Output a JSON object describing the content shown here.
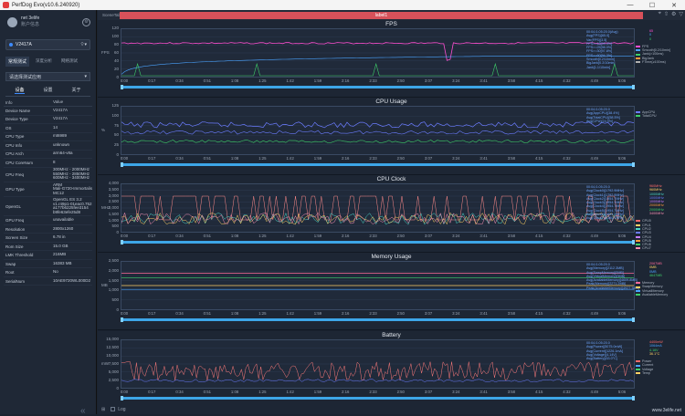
{
  "window": {
    "title": "PerfDog Evo(v10.6.240920)",
    "minimize": "—",
    "maximize": "☐",
    "close": "✕"
  },
  "user": {
    "name": "net 3elife",
    "tag": "账户信息"
  },
  "device": {
    "name": "V2417A"
  },
  "mode_tabs": [
    "常规测试",
    "深度分析",
    "网络测试"
  ],
  "app_select": {
    "placeholder": "请选择测试应用"
  },
  "sub_tabs": [
    "设备",
    "设置",
    "关于"
  ],
  "info_table": {
    "headers": [
      "Info",
      "Value"
    ],
    "rows": [
      [
        "Device Name",
        "V2417A"
      ],
      [
        "Device Type",
        "V2417A"
      ],
      [
        "OS",
        "14"
      ],
      [
        "CPU Type",
        "mt6989"
      ],
      [
        "CPU Info",
        "unknown"
      ],
      [
        "CPU Arch",
        "arm64-v8a"
      ],
      [
        "CPU CoreNum",
        "8"
      ],
      [
        "CPU Freq",
        "300MHz - 2000MHz\n550MHz - 2850MHz\n600MHz - 3400MHz"
      ],
      [
        "GPU Type",
        "ARM\nMali-G720-Immortalis\nMC12"
      ],
      [
        "OpenGL",
        "OpenGL ES 3.2\nv1.r49p1-01eac0.752\na177b6225fee3154\nb9fe63efe25d8"
      ],
      [
        "GPU Freq",
        "unavailable"
      ],
      [
        "Resolution",
        "2800x1260"
      ],
      [
        "Screen Size",
        "6.78 in"
      ],
      [
        "Rom Size",
        "15.0 GB"
      ],
      [
        "LMK Threshold",
        "216MB"
      ],
      [
        "Swap",
        "16383 MB"
      ],
      [
        "Root",
        "No"
      ],
      [
        "SerialNum",
        "10AE9720WL000D2"
      ]
    ]
  },
  "scene_tab": "SceneTab",
  "label_bar": "label1",
  "xticks": [
    "0:00",
    "0:17",
    "0:34",
    "0:51",
    "1:08",
    "1:25",
    "1:42",
    "1:59",
    "2:16",
    "2:33",
    "2:50",
    "3:07",
    "3:24",
    "3:41",
    "3:58",
    "4:15",
    "4:32",
    "4:49",
    "5:06"
  ],
  "panels": [
    {
      "title": "FPS",
      "unit": "FPS",
      "yticks": [
        "120",
        "100",
        "80",
        "60",
        "40",
        "20",
        "0"
      ],
      "stats": [
        "00:04.0-05:20.0(Avg)",
        "Avg(FPS)[65.0]",
        "Var(FPS)[3.5]",
        "FPS>=18[99.4%]",
        "FPS>=25[98.0%]",
        "FPS>=30[97.8%]",
        "FPS>=60[94.3%]",
        "Smooth[0.2/10min]",
        "BigJank[0.2/10min]",
        "Jank[1.1/10min]"
      ],
      "legend": [
        {
          "name": "FPS",
          "color": "#ff4fd1"
        },
        {
          "name": "Smooth[0.2/10min]",
          "color": "#4aa3ff"
        },
        {
          "name": "Jank(>100ms)",
          "color": "#3ecf6a"
        },
        {
          "name": "BigJank",
          "color": "#ff9a3c"
        },
        {
          "name": "FTime(≥100ms)",
          "color": "#b0b0b0"
        }
      ],
      "redvals": [
        "65",
        "0",
        "0"
      ]
    },
    {
      "title": "CPU Usage",
      "unit": "%",
      "yticks": [
        "125",
        "100",
        "75",
        "50",
        "25",
        "0"
      ],
      "stats": [
        "00:04.0-05:20.0",
        "Avg(AppCPU)[38.4%]",
        "Avg(TotalCPU)[58.5%]",
        "Avg(CPU)[24.9%]"
      ],
      "legend": [
        {
          "name": "AppCPU",
          "color": "#6b7cff"
        },
        {
          "name": "TotalCPU",
          "color": "#3ecf6a"
        }
      ],
      "redvals": []
    },
    {
      "title": "CPU Clock",
      "unit": "MHz",
      "yticks": [
        "4,000",
        "3,500",
        "3,000",
        "2,500",
        "2,000",
        "1,500",
        "1,000",
        "500",
        "0"
      ],
      "stats": [
        "00:04.0-05:20.0",
        "Avg(Clock0)[1792.9MHz]",
        "Avg(Clock1)[1792.9MHz]",
        "Avg(Clock2)[1954.7MHz]",
        "Avg(Clock3)[1954.7MHz]",
        "Avg(Clock4)[1954.7MHz]",
        "Avg(Clock5)[1954.7MHz]",
        "Avg(Clock6)[1954.7MHz]",
        "Avg(Clock7)[2380.1MHz]"
      ],
      "legend": [
        {
          "name": "CPU0",
          "color": "#ff6b6b"
        },
        {
          "name": "CPU1",
          "color": "#ffd166"
        },
        {
          "name": "CPU2",
          "color": "#4ad6c8"
        },
        {
          "name": "CPU3",
          "color": "#6b7cff"
        },
        {
          "name": "CPU4",
          "color": "#c77dff"
        },
        {
          "name": "CPU5",
          "color": "#ff9a3c"
        },
        {
          "name": "CPU6",
          "color": "#3ecf6a"
        },
        {
          "name": "CPU7",
          "color": "#f78fb3"
        }
      ],
      "redvals": [
        "960MHz",
        "960MHz",
        "1000MHz",
        "1000MHz",
        "1000MHz",
        "2000MHz",
        "2000MHz",
        "3400MHz"
      ]
    },
    {
      "title": "Memory Usage",
      "unit": "MB",
      "yticks": [
        "2,500",
        "2,000",
        "1,500",
        "1,000",
        "500",
        "0"
      ],
      "stats": [
        "00:04.0-05:20.0",
        "Avg(Memory)[2112.3MB]",
        "Avg(SwapMemory)[0MB]",
        "Avg(VirtualMemory)[0MB]",
        "Avg(AvailableMemory)[4609.8MB]",
        "Peak(Memory)[2271.2MB]",
        "Peak(AvailableMemory)[4927.3MB]"
      ],
      "legend": [
        {
          "name": "Memory",
          "color": "#ff6b9a"
        },
        {
          "name": "SwapMemory",
          "color": "#ffd166"
        },
        {
          "name": "VirtualMemory",
          "color": "#4aa3ff"
        },
        {
          "name": "AvailableMemory",
          "color": "#3ecf6a"
        }
      ],
      "redvals": [
        "2067MB",
        "0MB",
        "0MB",
        "4647MB"
      ]
    },
    {
      "title": "Battery",
      "unit": "mW",
      "yticks": [
        "15,000",
        "12,500",
        "10,000",
        "7,500",
        "5,000",
        "2,500",
        "0"
      ],
      "stats": [
        "00:04.0-05:20.0",
        "Avg(Power)[5075.0mW]",
        "Avg(Current)[1226.1mA]",
        "Avg(Voltage)[4.14V]",
        "Avg(Battery)[63.0°C]"
      ],
      "legend": [
        {
          "name": "Power",
          "color": "#ff6b6b"
        },
        {
          "name": "Current",
          "color": "#4aa3ff"
        },
        {
          "name": "Voltage",
          "color": "#3ecf6a"
        },
        {
          "name": "Temp",
          "color": "#ffd166"
        }
      ],
      "redvals": [
        "4400mW",
        "1064mA",
        "4.16V",
        "36.1°C"
      ]
    }
  ],
  "bottom": {
    "log_label": "Log"
  },
  "watermark": "www.3elife.net"
}
